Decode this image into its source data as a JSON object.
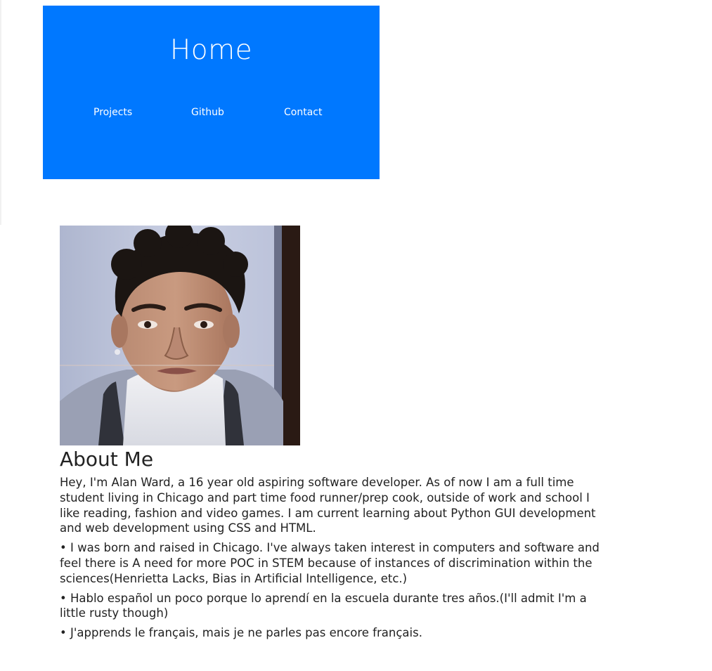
{
  "header": {
    "title": "Home",
    "nav": [
      {
        "label": "Projects"
      },
      {
        "label": "Github"
      },
      {
        "label": "Contact"
      }
    ],
    "background_color": "#0078ff"
  },
  "profile": {
    "photo_alt": "Portrait of Alan Ward"
  },
  "about": {
    "title": "About Me",
    "paragraphs": [
      "Hey, I'm Alan Ward, a 16 year old aspiring software developer. As of now I am a full time student living in Chicago and part time food runner/prep cook, outside of work and school I like reading, fashion and video games. I am current learning about Python GUI development and web development using CSS and HTML.",
      "• I was born and raised in Chicago. I've always taken interest in computers and software and feel there is A need for more POC in STEM because of instances of discrimination within the sciences(Henrietta Lacks, Bias in Artificial Intelligence, etc.)",
      "• Hablo español un poco porque lo aprendí en la escuela durante tres años.(I'll admit I'm a little rusty though)",
      "• J'apprends le français, mais je ne parles pas encore français."
    ]
  }
}
